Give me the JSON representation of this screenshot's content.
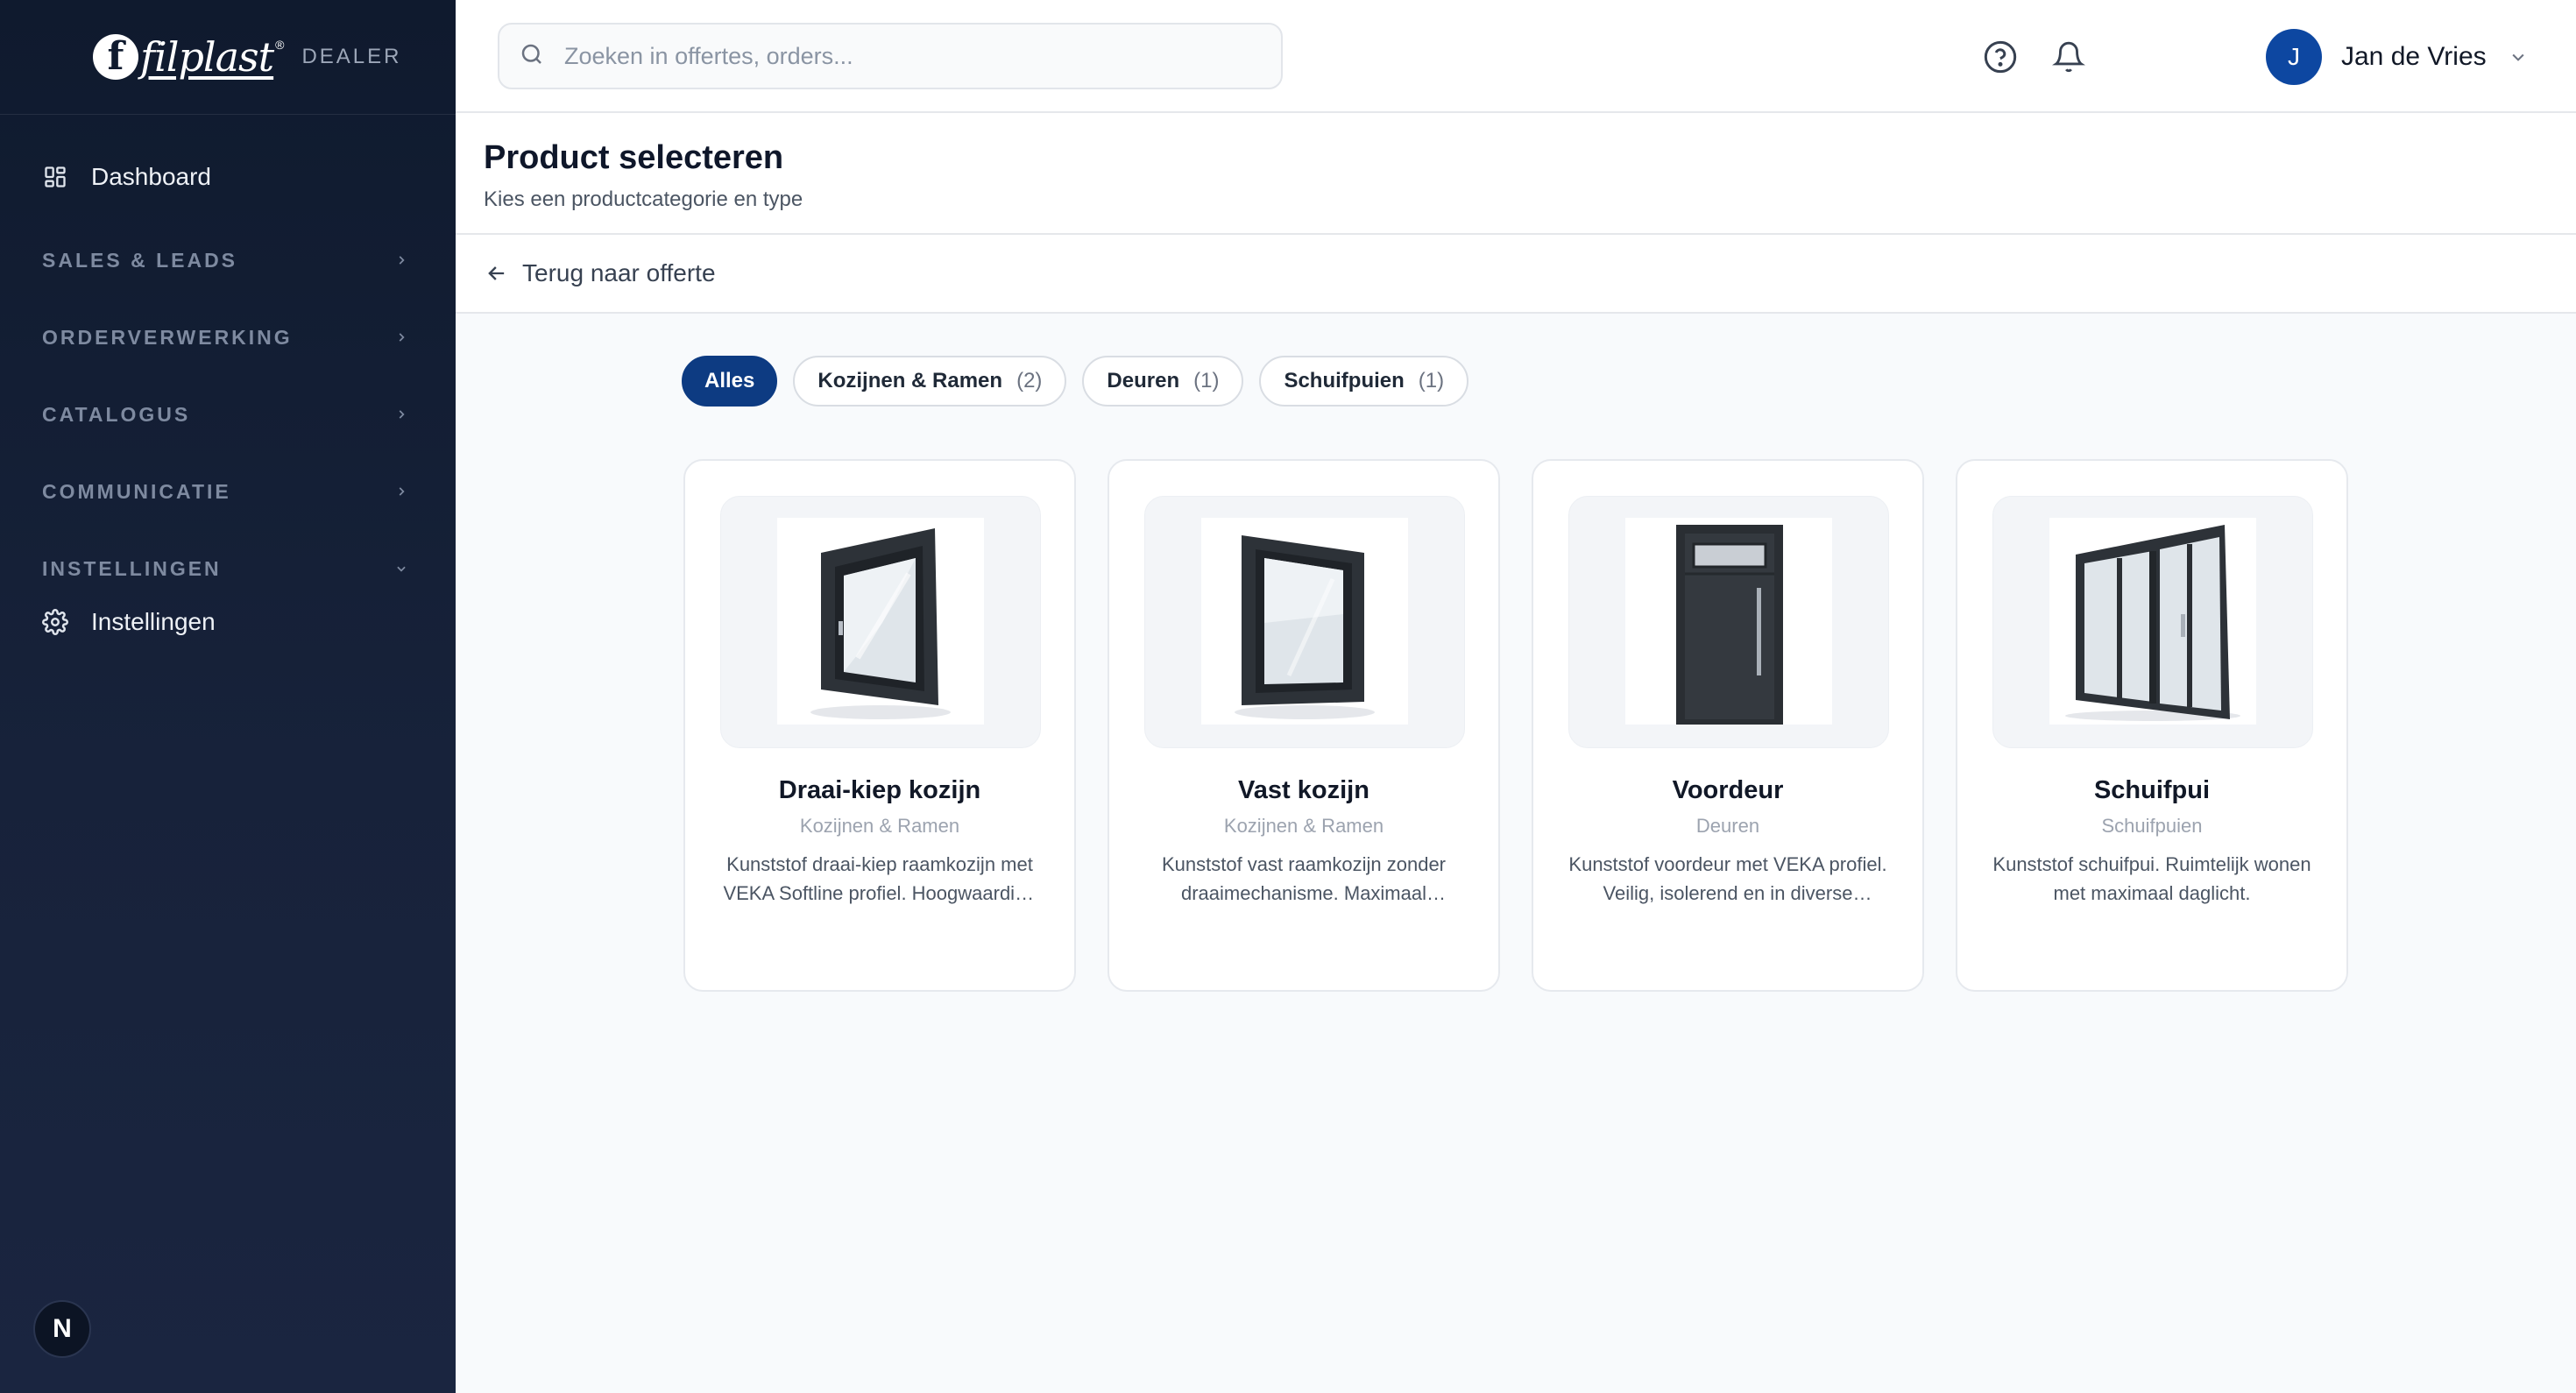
{
  "brand": {
    "logo_letter": "f",
    "logo_word": "filplast",
    "logo_reg": "®",
    "tag": "DEALER"
  },
  "sidebar": {
    "dashboard": "Dashboard",
    "groups": [
      {
        "label": "SALES & LEADS",
        "state": "collapsed"
      },
      {
        "label": "ORDERVERWERKING",
        "state": "collapsed"
      },
      {
        "label": "CATALOGUS",
        "state": "collapsed"
      },
      {
        "label": "COMMUNICATIE",
        "state": "collapsed"
      },
      {
        "label": "INSTELLINGEN",
        "state": "expanded"
      }
    ],
    "settings_item": "Instellingen",
    "badge": "N"
  },
  "topbar": {
    "search_placeholder": "Zoeken in offertes, orders...",
    "help_icon": "help-circle-icon",
    "bell_icon": "bell-icon",
    "user_initial": "J",
    "user_name": "Jan de Vries"
  },
  "page": {
    "title": "Product selecteren",
    "subtitle": "Kies een productcategorie en type",
    "back_label": "Terug naar offerte"
  },
  "filters": [
    {
      "label": "Alles",
      "count": "",
      "active": true
    },
    {
      "label": "Kozijnen & Ramen",
      "count": "(2)",
      "active": false
    },
    {
      "label": "Deuren",
      "count": "(1)",
      "active": false
    },
    {
      "label": "Schuifpuien",
      "count": "(1)",
      "active": false
    }
  ],
  "products": [
    {
      "name": "Draai-kiep kozijn",
      "category": "Kozijnen & Ramen",
      "description": "Kunststof draai-kiep raamkozijn met VEKA Softline profiel. Hoogwaardige isolatie en veiligheid."
    },
    {
      "name": "Vast kozijn",
      "category": "Kozijnen & Ramen",
      "description": "Kunststof vast raamkozijn zonder draaimechanisme. Maximaal lichtinval en isolatie."
    },
    {
      "name": "Voordeur",
      "category": "Deuren",
      "description": "Kunststof voordeur met VEKA profiel. Veilig, isolerend en in diverse uitvoeringen."
    },
    {
      "name": "Schuifpui",
      "category": "Schuifpuien",
      "description": "Kunststof schuifpui. Ruimtelijk wonen met maximaal daglicht."
    }
  ],
  "colors": {
    "primary": "#0d3b82",
    "avatar": "#0d47a1",
    "sidebar": "#0f1a2e"
  }
}
